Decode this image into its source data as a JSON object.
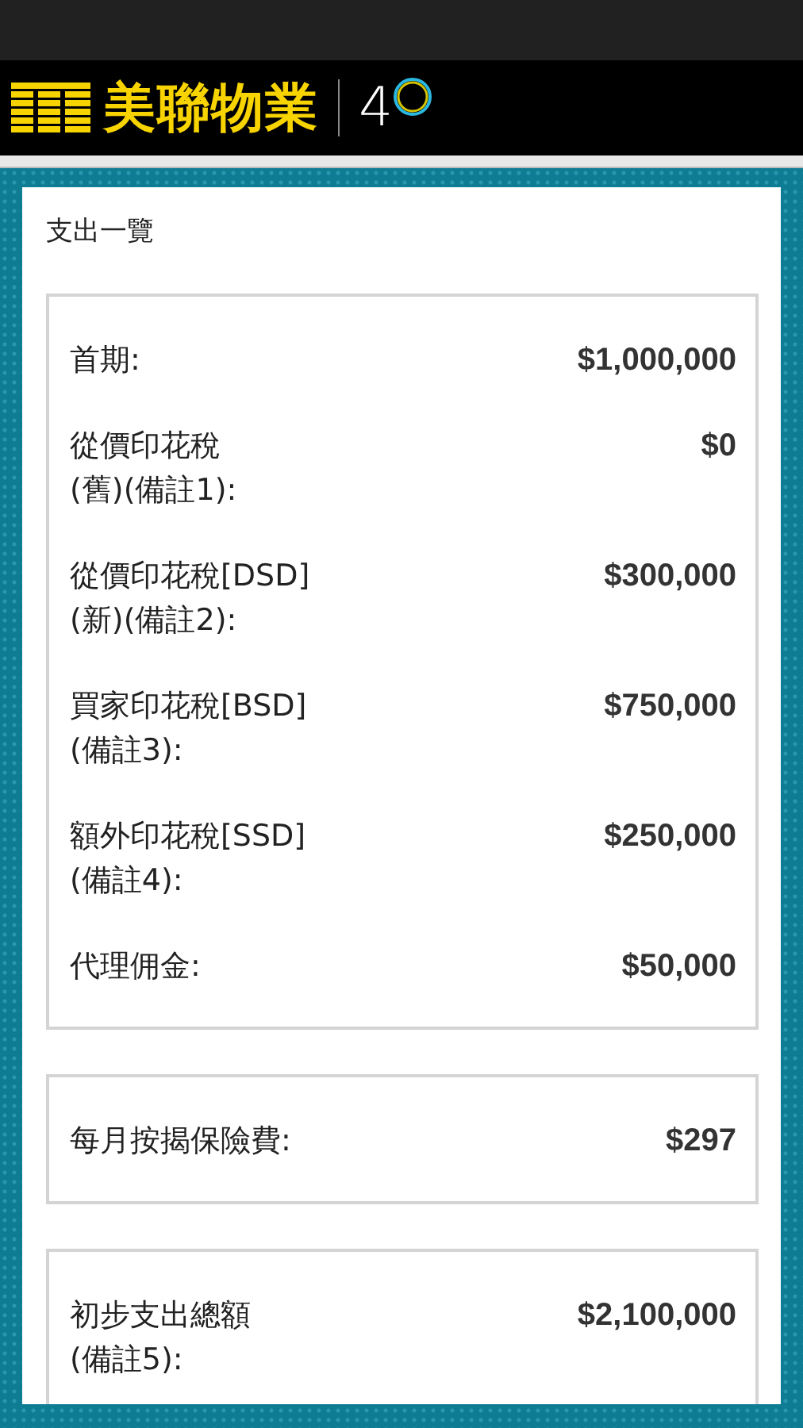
{
  "header": {
    "brand": "美聯物業",
    "anniversary": "4"
  },
  "card": {
    "title": "支出一覽",
    "groups": [
      {
        "rows": [
          {
            "label": "首期:",
            "value": "$1,000,000"
          },
          {
            "label": "從價印花稅\n(舊)(備註1):",
            "value": "$0"
          },
          {
            "label": "從價印花稅[DSD]\n(新)(備註2):",
            "value": "$300,000"
          },
          {
            "label": "買家印花稅[BSD]\n(備註3):",
            "value": "$750,000"
          },
          {
            "label": "額外印花稅[SSD]\n(備註4):",
            "value": "$250,000"
          },
          {
            "label": "代理佣金:",
            "value": "$50,000"
          }
        ]
      },
      {
        "rows": [
          {
            "label": "每月按揭保險費:",
            "value": "$297"
          }
        ]
      },
      {
        "rows": [
          {
            "label": "初步支出總額\n(備註5):",
            "value": "$2,100,000"
          }
        ]
      }
    ]
  }
}
